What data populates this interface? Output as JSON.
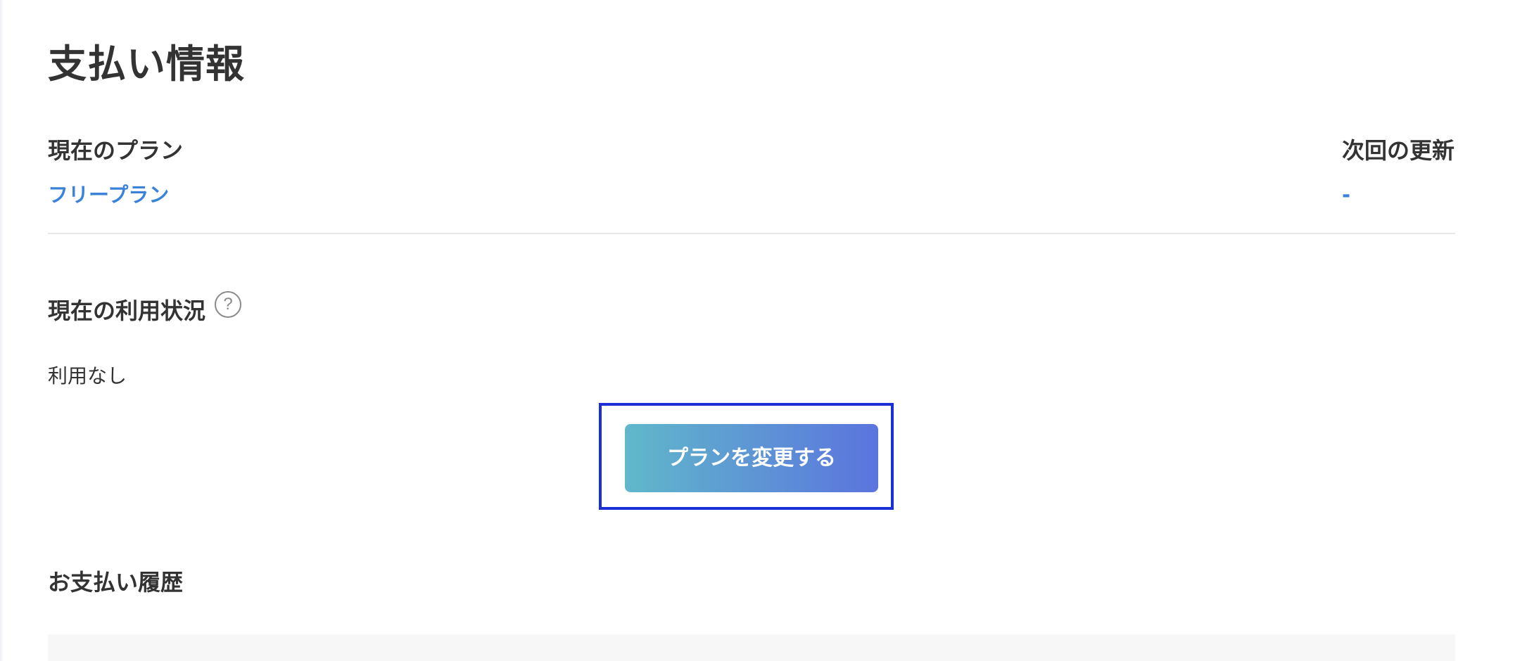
{
  "page": {
    "title": "支払い情報"
  },
  "plan": {
    "label": "現在のプラン",
    "value": "フリープラン"
  },
  "renewal": {
    "label": "次回の更新",
    "value": "-"
  },
  "usage": {
    "label": "現在の利用状況",
    "help_icon": "question-circle-icon",
    "help_glyph": "?",
    "value": "利用なし"
  },
  "actions": {
    "change_plan_label": "プランを変更する"
  },
  "history": {
    "label": "お支払い履歴"
  },
  "colors": {
    "link": "#3b82d9",
    "button_gradient_start": "#60b8ca",
    "button_gradient_end": "#5b74de",
    "focus_frame": "#1a2fd6",
    "text": "#333333"
  }
}
